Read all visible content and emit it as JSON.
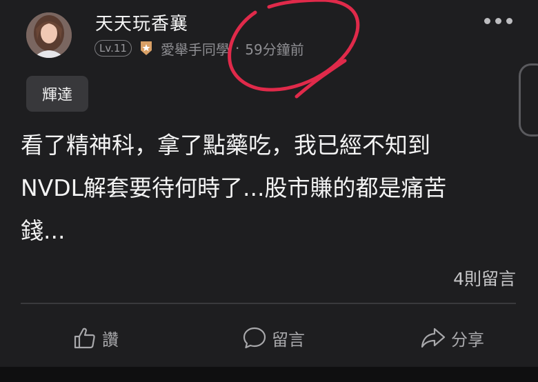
{
  "post": {
    "author": "天天玩香襄",
    "level": "Lv.11",
    "school": "愛舉手同學",
    "separator": "·",
    "time": "59分鐘前",
    "tag": "輝達",
    "content": "看了精神科，拿了點藥吃，我已經不知到\nNVDL解套要待何時了...股市賺的都是痛苦\n錢...",
    "comment_count": "4則留言"
  },
  "actions": {
    "like": "讚",
    "comment": "留言",
    "share": "分享"
  },
  "icons": {
    "more": "more-icon",
    "badge": "badge-icon",
    "like": "thumbs-up-icon",
    "comment": "comment-icon",
    "share": "share-icon"
  },
  "colors": {
    "background": "#1e1e20",
    "annotation": "#e02a4a"
  }
}
